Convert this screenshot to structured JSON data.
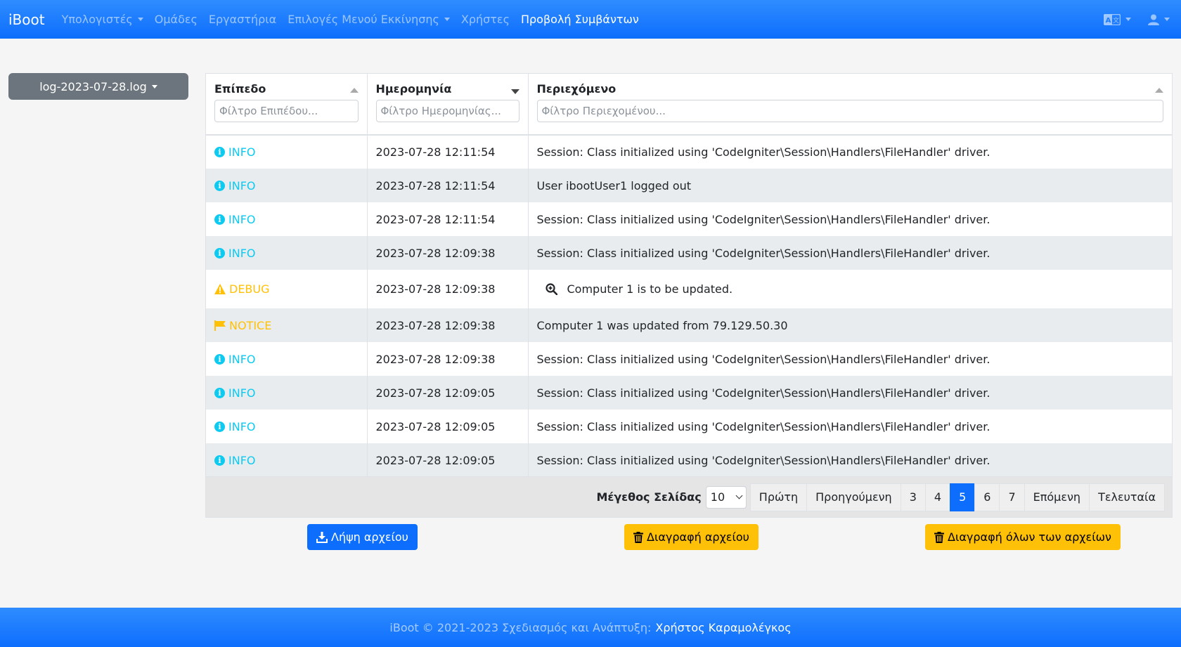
{
  "navbar": {
    "brand": "iBoot",
    "items": [
      {
        "label": "Υπολογιστές",
        "dropdown": true,
        "active": false
      },
      {
        "label": "Ομάδες",
        "dropdown": false,
        "active": false
      },
      {
        "label": "Εργαστήρια",
        "dropdown": false,
        "active": false
      },
      {
        "label": "Επιλογές Μενού Εκκίνησης",
        "dropdown": true,
        "active": false
      },
      {
        "label": "Χρήστες",
        "dropdown": false,
        "active": false
      },
      {
        "label": "Προβολή Συμβάντων",
        "dropdown": false,
        "active": true
      }
    ],
    "right_icons": [
      "language-icon",
      "user-icon"
    ]
  },
  "file_dropdown": {
    "label": "log-2023-07-28.log"
  },
  "table": {
    "columns": [
      {
        "label": "Επίπεδο",
        "placeholder": "Φίλτρο Επιπέδου...",
        "sort": "none"
      },
      {
        "label": "Ημερομηνία",
        "placeholder": "Φίλτρο Ημερομηνίας...",
        "sort": "desc"
      },
      {
        "label": "Περιεχόμενο",
        "placeholder": "Φίλτρο Περιεχομένου...",
        "sort": "none"
      }
    ],
    "rows": [
      {
        "level": "INFO",
        "icon": "info-icon",
        "date": "2023-07-28 12:11:54",
        "content": "Session: Class initialized using 'CodeIgniter\\Session\\Handlers\\FileHandler' driver."
      },
      {
        "level": "INFO",
        "icon": "info-icon",
        "date": "2023-07-28 12:11:54",
        "content": "User ibootUser1 logged out"
      },
      {
        "level": "INFO",
        "icon": "info-icon",
        "date": "2023-07-28 12:11:54",
        "content": "Session: Class initialized using 'CodeIgniter\\Session\\Handlers\\FileHandler' driver."
      },
      {
        "level": "INFO",
        "icon": "info-icon",
        "date": "2023-07-28 12:09:38",
        "content": "Session: Class initialized using 'CodeIgniter\\Session\\Handlers\\FileHandler' driver."
      },
      {
        "level": "DEBUG",
        "icon": "warning-icon",
        "date": "2023-07-28 12:09:38",
        "content": "Computer 1 is to be updated.",
        "has_zoom": true
      },
      {
        "level": "NOTICE",
        "icon": "flag-icon",
        "date": "2023-07-28 12:09:38",
        "content": "Computer 1 was updated from 79.129.50.30"
      },
      {
        "level": "INFO",
        "icon": "info-icon",
        "date": "2023-07-28 12:09:38",
        "content": "Session: Class initialized using 'CodeIgniter\\Session\\Handlers\\FileHandler' driver."
      },
      {
        "level": "INFO",
        "icon": "info-icon",
        "date": "2023-07-28 12:09:05",
        "content": "Session: Class initialized using 'CodeIgniter\\Session\\Handlers\\FileHandler' driver."
      },
      {
        "level": "INFO",
        "icon": "info-icon",
        "date": "2023-07-28 12:09:05",
        "content": "Session: Class initialized using 'CodeIgniter\\Session\\Handlers\\FileHandler' driver."
      },
      {
        "level": "INFO",
        "icon": "info-icon",
        "date": "2023-07-28 12:09:05",
        "content": "Session: Class initialized using 'CodeIgniter\\Session\\Handlers\\FileHandler' driver."
      }
    ]
  },
  "pagination": {
    "page_size_label": "Μέγεθος Σελίδας",
    "page_size_value": "10",
    "first": "Πρώτη",
    "previous": "Προηγούμενη",
    "pages": [
      "3",
      "4",
      "5",
      "6",
      "7"
    ],
    "current_page": "5",
    "next": "Επόμενη",
    "last": "Τελευταία"
  },
  "actions": {
    "download": "Λήψη αρχείου",
    "delete": "Διαγραφή αρχείου",
    "delete_all": "Διαγραφή όλων των αρχείων"
  },
  "footer": {
    "text": "iBoot © 2021-2023 Σχεδιασμός και Ανάπτυξη:",
    "author": "Χρήστος Καραμολέγκος"
  },
  "colors": {
    "primary": "#0d6efd",
    "info": "#0dcaf0",
    "warning": "#ffc107",
    "secondary": "#6c757d"
  }
}
